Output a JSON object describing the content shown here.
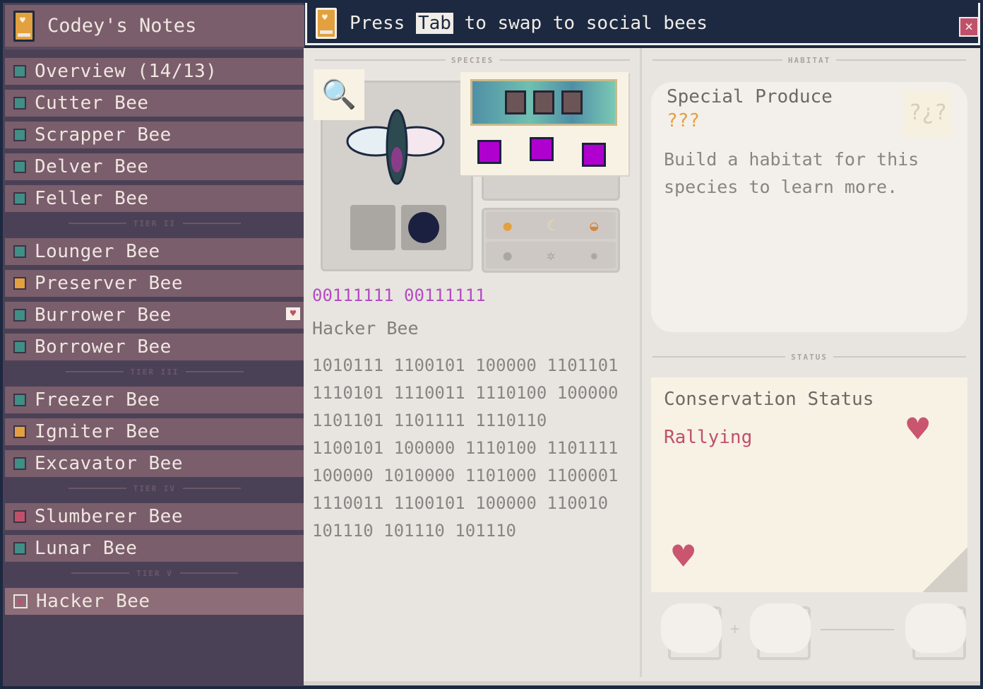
{
  "sidebar": {
    "title": "Codey's Notes",
    "items": [
      {
        "label": "Overview (14/13)",
        "color": "#3f8f86"
      },
      {
        "label": "Cutter Bee",
        "color": "#3f8f86"
      },
      {
        "label": "Scrapper Bee",
        "color": "#3f8f86"
      },
      {
        "label": "Delver Bee",
        "color": "#3f8f86"
      },
      {
        "label": "Feller Bee",
        "color": "#3f8f86"
      },
      {
        "label": "Lounger Bee",
        "color": "#3f8f86"
      },
      {
        "label": "Preserver Bee",
        "color": "#e3a03f"
      },
      {
        "label": "Burrower Bee",
        "color": "#3f8f86"
      },
      {
        "label": "Borrower Bee",
        "color": "#3f8f86"
      },
      {
        "label": "Freezer Bee",
        "color": "#3f8f86"
      },
      {
        "label": "Igniter Bee",
        "color": "#e3a03f"
      },
      {
        "label": "Excavator Bee",
        "color": "#3f8f86"
      },
      {
        "label": "Slumberer Bee",
        "color": "#c0506a"
      },
      {
        "label": "Lunar Bee",
        "color": "#3f8f86"
      },
      {
        "label": "Hacker Bee",
        "selected": true
      }
    ],
    "tiers": [
      "TIER II",
      "TIER III",
      "TIER IV",
      "TIER V"
    ]
  },
  "topbar": {
    "pre": "Press ",
    "key": "Tab",
    "post": " to swap to social bees",
    "close": "×"
  },
  "species": {
    "section": "SPECIES",
    "binary_name": "00111111 00111111",
    "name": "Hacker Bee",
    "description": "1010111 1100101 100000 1101101 1110101 1110011 1110100 100000 1101101 1101111 1110110 1100101 100000 1110100 1101111 100000 1010000 1101000 1100001 1110011 1100101 100000 110010 101110 101110 101110"
  },
  "habitat": {
    "section": "HABITAT",
    "produce_label": "Special Produce",
    "produce_value": "???",
    "text": "Build a habitat for this species to learn more."
  },
  "status": {
    "section": "STATUS",
    "label": "Conservation Status",
    "value": "Rallying"
  },
  "colors": {
    "accent": "#c0506a",
    "sidebar": "#7a5e6b",
    "topbar": "#1c2940",
    "material": "#b000d0"
  }
}
